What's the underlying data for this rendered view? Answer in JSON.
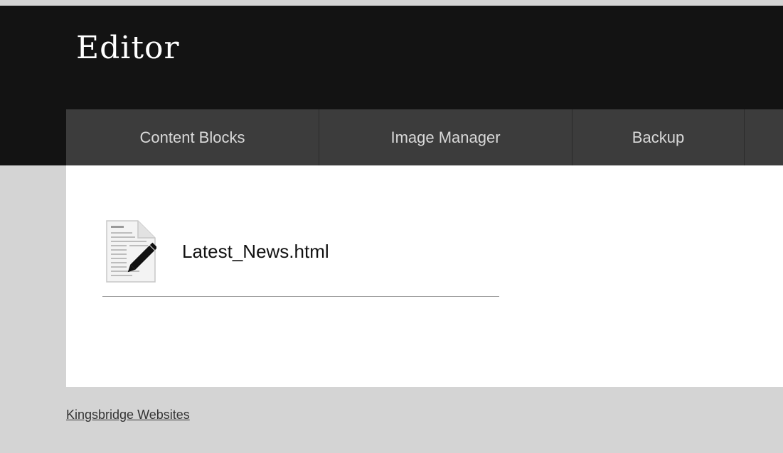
{
  "header": {
    "title": "Editor"
  },
  "nav": {
    "tabs": [
      {
        "label": "Content Blocks"
      },
      {
        "label": "Image Manager"
      },
      {
        "label": "Backup"
      },
      {
        "label": ""
      }
    ]
  },
  "main": {
    "files": [
      {
        "name": "Latest_News.html",
        "icon": "html-document-edit-icon"
      }
    ]
  },
  "footer": {
    "link_text": "Kingsbridge Websites"
  },
  "colors": {
    "header_bg": "#131313",
    "nav_bg": "#3c3c3c",
    "nav_text": "#d9d9d9",
    "page_bg": "#d4d4d4",
    "content_bg": "#ffffff"
  }
}
